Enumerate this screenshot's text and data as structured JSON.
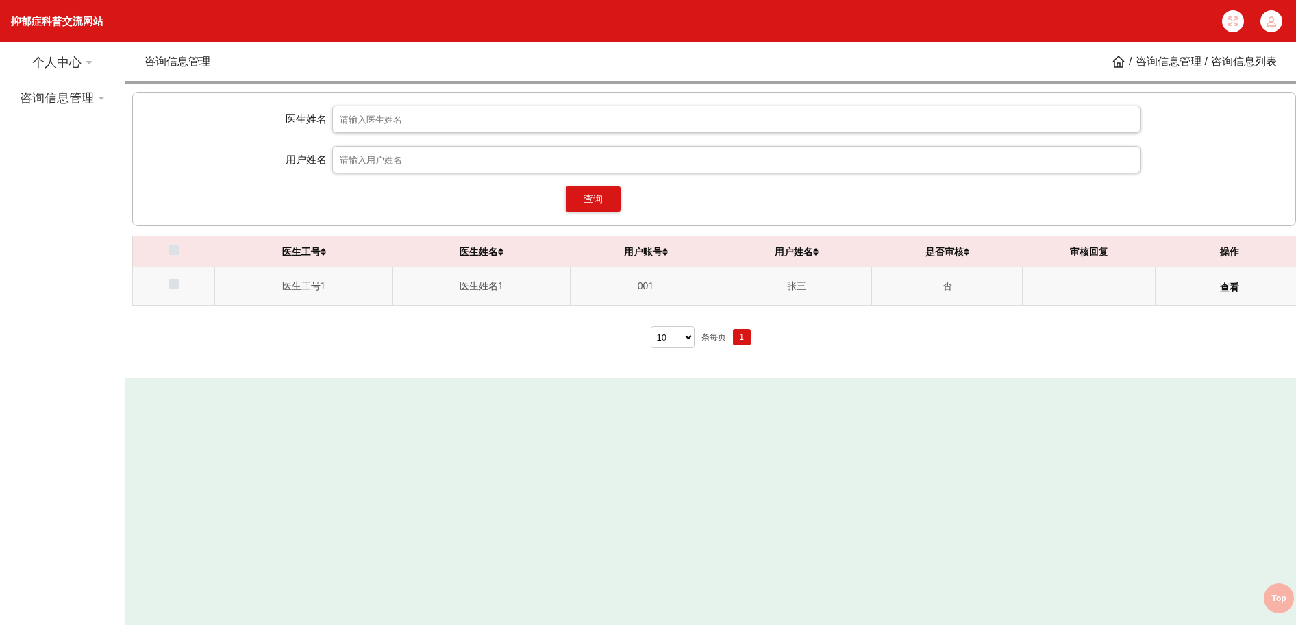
{
  "header": {
    "title": "抑郁症科普交流网站"
  },
  "sidebar": {
    "items": [
      {
        "label": "个人中心",
        "expanded": false
      },
      {
        "label": "咨询信息管理",
        "expanded": false
      }
    ]
  },
  "page_title": "咨询信息管理",
  "breadcrumb": {
    "separator": "/",
    "items": [
      "咨询信息管理",
      "咨询信息列表"
    ]
  },
  "search": {
    "fields": [
      {
        "label": "医生姓名",
        "placeholder": "请输入医生姓名"
      },
      {
        "label": "用户姓名",
        "placeholder": "请输入用户姓名"
      }
    ],
    "button": "查询"
  },
  "table": {
    "select_all": {
      "checked": false
    },
    "columns": [
      {
        "label": "医生工号",
        "sortable": true
      },
      {
        "label": "医生姓名",
        "sortable": true
      },
      {
        "label": "用户账号",
        "sortable": true
      },
      {
        "label": "用户姓名",
        "sortable": true
      },
      {
        "label": "是否审核",
        "sortable": true
      },
      {
        "label": "审核回复",
        "sortable": false
      },
      {
        "label": "操作",
        "sortable": false
      }
    ],
    "rows": [
      {
        "checked": false,
        "cells": [
          "医生工号1",
          "医生姓名1",
          "001",
          "张三",
          "否",
          ""
        ],
        "action": "查看"
      }
    ]
  },
  "pagination": {
    "page_size": "10",
    "page_size_label": "条每页",
    "pages": [
      {
        "label": "1",
        "selected": true
      }
    ]
  },
  "back_to_top": "Top"
}
